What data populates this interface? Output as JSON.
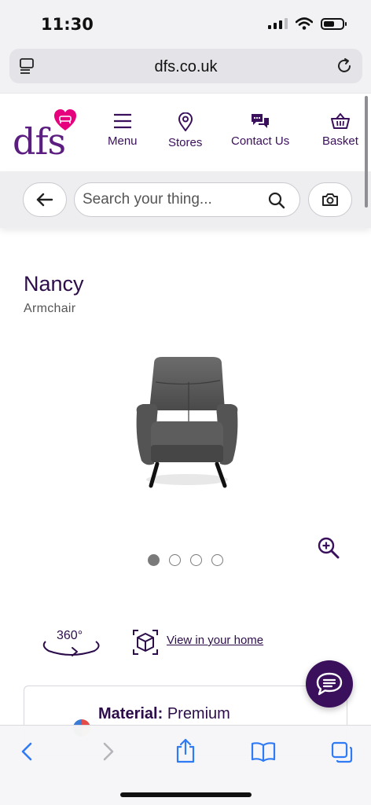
{
  "status_bar": {
    "time": "11:30",
    "battery_level": 0.6
  },
  "browser": {
    "url": "dfs.co.uk"
  },
  "site": {
    "logo_text": "dfs",
    "nav": [
      {
        "label": "Menu",
        "icon": "hamburger-icon"
      },
      {
        "label": "Stores",
        "icon": "location-pin-icon"
      },
      {
        "label": "Contact Us",
        "icon": "chat-bubbles-icon"
      },
      {
        "label": "Basket",
        "icon": "basket-icon"
      }
    ],
    "search": {
      "placeholder": "Search your thing..."
    }
  },
  "product": {
    "name": "Nancy",
    "type": "Armchair",
    "gallery": {
      "image_count": 4,
      "active_index": 0
    },
    "features": {
      "view_360": "360°",
      "view_in_home": "View in your home"
    },
    "material": {
      "label": "Material:",
      "value": "Premium"
    }
  },
  "colors": {
    "brand_purple": "#3a0f5c",
    "logo_purple": "#5b1e80",
    "logo_pink": "#e6007e",
    "ios_blue": "#2f7bf6"
  }
}
